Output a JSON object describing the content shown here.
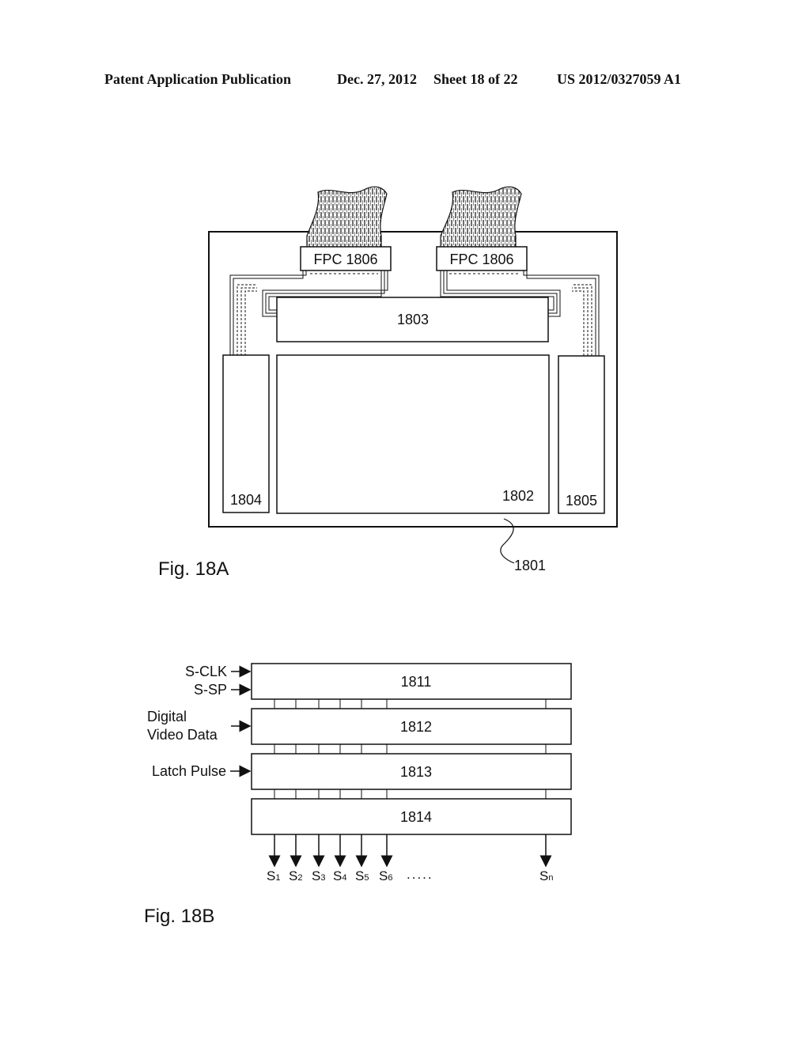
{
  "header": {
    "publication": "Patent Application Publication",
    "date": "Dec. 27, 2012",
    "sheet": "Sheet 18 of 22",
    "number": "US 2012/0327059 A1"
  },
  "fig18a": {
    "caption": "Fig. 18A",
    "substrate_label": "1801",
    "pixel_area_label": "1802",
    "source_driver_label": "1803",
    "gate_driver_left_label": "1804",
    "gate_driver_right_label": "1805",
    "fpc_left_label": "FPC 1806",
    "fpc_right_label": "FPC 1806"
  },
  "fig18b": {
    "caption": "Fig. 18B",
    "blocks": [
      "1811",
      "1812",
      "1813",
      "1814"
    ],
    "inputs": {
      "sclk": "S-CLK",
      "ssp": "S-SP",
      "video_line1": "Digital",
      "video_line2": "Video Data",
      "latch": "Latch Pulse"
    },
    "outputs": [
      {
        "base": "S",
        "sub": "1"
      },
      {
        "base": "S",
        "sub": "2"
      },
      {
        "base": "S",
        "sub": "3"
      },
      {
        "base": "S",
        "sub": "4"
      },
      {
        "base": "S",
        "sub": "5"
      },
      {
        "base": "S",
        "sub": "6"
      },
      {
        "base": "S",
        "sub": "n"
      }
    ],
    "ellipsis": "....."
  }
}
